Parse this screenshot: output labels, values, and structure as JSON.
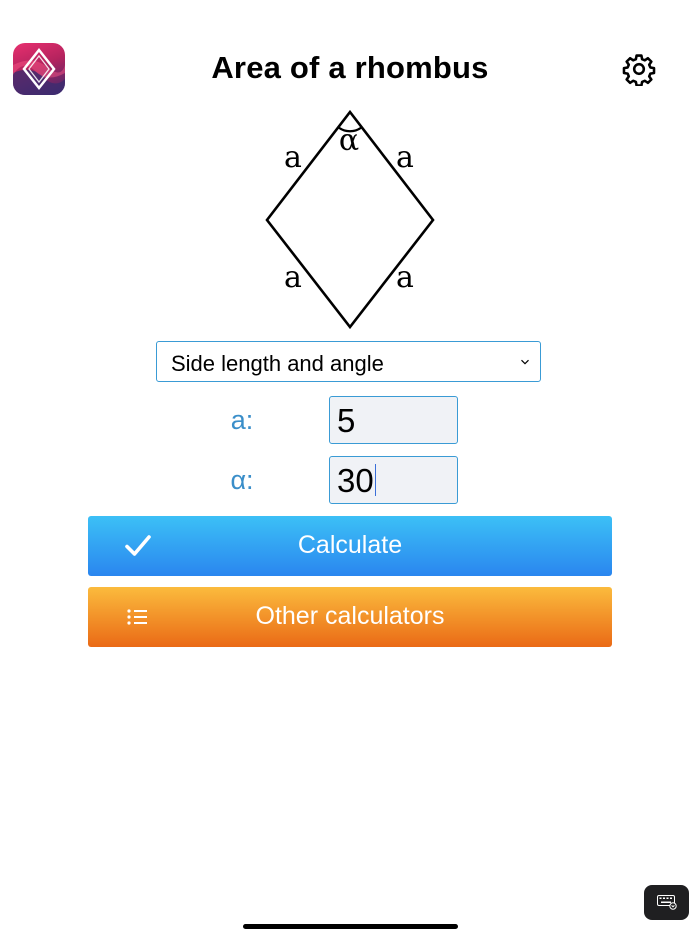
{
  "header": {
    "title": "Area of a rhombus",
    "app_icon": "rhombus-app-icon",
    "settings_icon": "gear-icon"
  },
  "figure": {
    "side_labels": [
      "a",
      "a",
      "a",
      "a"
    ],
    "angle_label": "α"
  },
  "mode_select": {
    "selected": "Side length and angle",
    "icon": "chevron-down-icon"
  },
  "fields": [
    {
      "label": "a:",
      "value": "5"
    },
    {
      "label": "α:",
      "value": "30"
    }
  ],
  "buttons": {
    "calculate": {
      "label": "Calculate",
      "icon": "checkmark-icon",
      "colors": [
        "#3cc0f6",
        "#2a86ef"
      ]
    },
    "other": {
      "label": "Other calculators",
      "icon": "list-icon",
      "colors": [
        "#fbbb3d",
        "#ea6a16"
      ]
    }
  },
  "keyboard_toggle": {
    "icon": "keyboard-hide-icon"
  },
  "colors": {
    "accent": "#3a9bd5",
    "label": "#3a8ec9"
  }
}
